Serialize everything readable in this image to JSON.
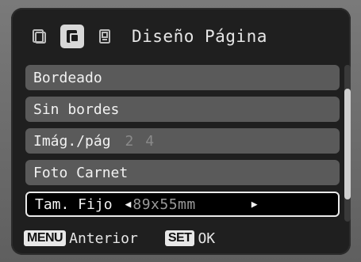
{
  "header": {
    "tabs": [
      {
        "icon": "print-layout-icon-1",
        "active": false
      },
      {
        "icon": "print-layout-icon-2",
        "active": true
      },
      {
        "icon": "print-layout-icon-3",
        "active": false
      }
    ],
    "title": "Diseño Página"
  },
  "list": {
    "items": [
      {
        "label": "Bordeado"
      },
      {
        "label": "Sin bordes"
      },
      {
        "label": "Imág./pág",
        "value": "2 4"
      },
      {
        "label": "Foto Carnet"
      },
      {
        "label": "Tam. Fijo",
        "value": "89x55mm"
      }
    ]
  },
  "footer": {
    "menu_key": "MENU",
    "menu_label": "Anterior",
    "set_key": "SET",
    "set_label": "OK"
  },
  "colors": {
    "panel": "#1f1f1f",
    "item": "#5a5a5a",
    "selected_border": "#eaeaea",
    "text": "#f2f2f2"
  }
}
